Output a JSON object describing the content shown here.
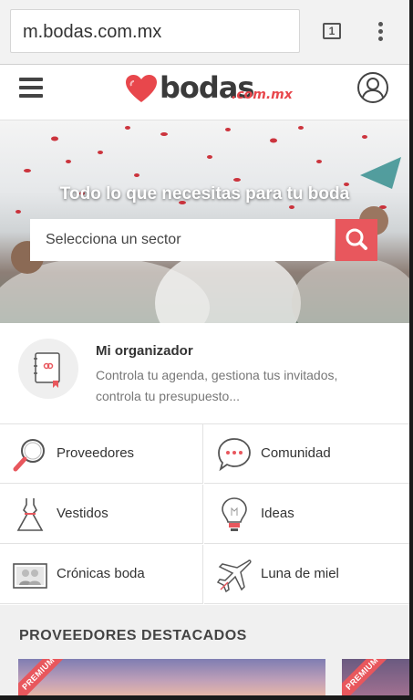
{
  "browser": {
    "url": "m.bodas.com.mx",
    "tab_count": "1"
  },
  "header": {
    "logo_text": "bodas",
    "logo_suffix": ".com.mx"
  },
  "hero": {
    "title": "Todo lo que necesitas para tu boda",
    "search_placeholder": "Selecciona un sector"
  },
  "organizer": {
    "title": "Mi organizador",
    "description": "Controla tu agenda, gestiona tus invitados, controla tu presupuesto..."
  },
  "categories": [
    {
      "label": "Proveedores",
      "icon": "magnifier-icon"
    },
    {
      "label": "Comunidad",
      "icon": "chat-bubble-icon"
    },
    {
      "label": "Vestidos",
      "icon": "dress-icon"
    },
    {
      "label": "Ideas",
      "icon": "lightbulb-icon"
    },
    {
      "label": "Crónicas boda",
      "icon": "photo-couple-icon"
    },
    {
      "label": "Luna de miel",
      "icon": "airplane-icon"
    }
  ],
  "featured": {
    "title": "PROVEEDORES DESTACADOS",
    "badges": [
      "PREMIUM",
      "PREMIUM"
    ]
  },
  "colors": {
    "accent": "#e8575d",
    "text": "#333333"
  }
}
